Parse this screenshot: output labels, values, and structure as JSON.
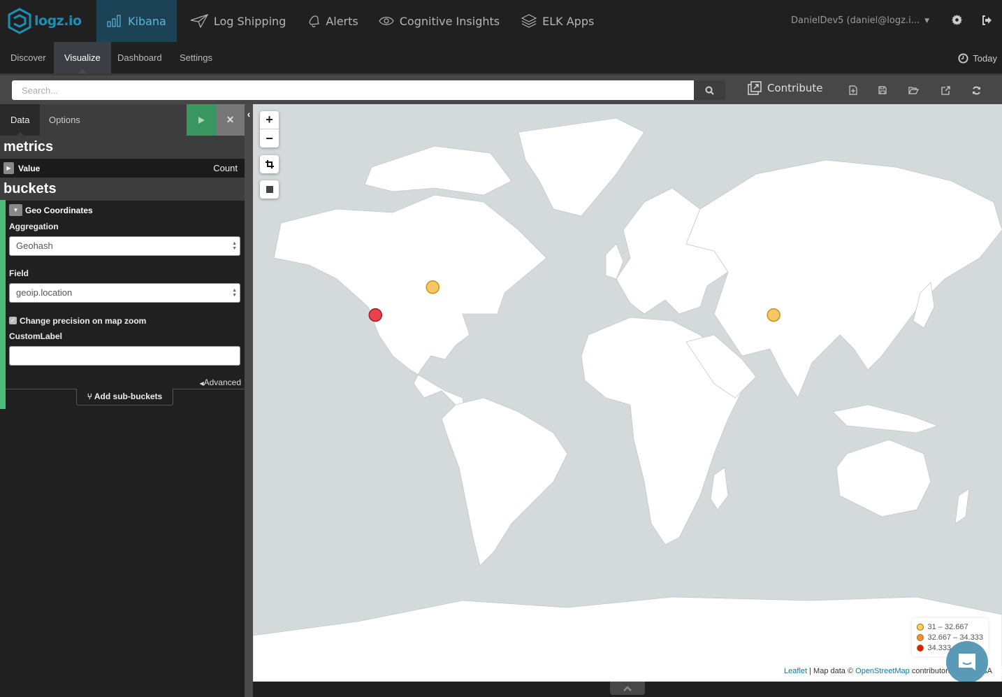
{
  "brand": {
    "name": "logz.io",
    "color": "#1c8fb8"
  },
  "topnav": {
    "items": [
      {
        "label": "Kibana",
        "icon": "bar-chart-icon",
        "active": true
      },
      {
        "label": "Log Shipping",
        "icon": "paper-plane-icon",
        "active": false
      },
      {
        "label": "Alerts",
        "icon": "bell-icon",
        "active": false
      },
      {
        "label": "Cognitive Insights",
        "icon": "eye-icon",
        "active": false
      },
      {
        "label": "ELK Apps",
        "icon": "layers-icon",
        "active": false
      }
    ],
    "user": "DanielDev5 (daniel@logz.i...",
    "settings_icon": "gear-icon",
    "logout_icon": "sign-out-icon"
  },
  "subnav": {
    "tabs": [
      {
        "label": "Discover",
        "active": false
      },
      {
        "label": "Visualize",
        "active": true
      },
      {
        "label": "Dashboard",
        "active": false
      },
      {
        "label": "Settings",
        "active": false
      }
    ],
    "time_label": "Today"
  },
  "toolbar": {
    "search_placeholder": "Search...",
    "search_value": "",
    "contribute_label": "Contribute",
    "icons": [
      "new-visualization-icon",
      "save-icon",
      "open-icon",
      "share-icon",
      "refresh-icon"
    ]
  },
  "sidebar": {
    "tabs": [
      {
        "label": "Data",
        "active": true
      },
      {
        "label": "Options",
        "active": false
      }
    ],
    "metrics_title": "metrics",
    "metric": {
      "name": "Value",
      "type": "Count"
    },
    "buckets_title": "buckets",
    "bucket": {
      "title": "Geo Coordinates",
      "aggregation_label": "Aggregation",
      "aggregation_value": "Geohash",
      "field_label": "Field",
      "field_value": "geoip.location",
      "precision_label": "Change precision on map zoom",
      "precision_checked": true,
      "custom_label_label": "CustomLabel",
      "custom_label_value": "",
      "advanced_label": "Advanced"
    },
    "add_sub_buckets_label": "Add sub-buckets"
  },
  "map": {
    "controls": {
      "zoom_in": "+",
      "zoom_out": "−"
    },
    "legend": [
      {
        "label": "31 – 32.667",
        "color": "#fdd35c"
      },
      {
        "label": "32.667 – 34.333",
        "color": "#fd8d3c"
      },
      {
        "label": "34.333 – 36",
        "color": "#e31a1c"
      }
    ],
    "markers": [
      {
        "name": "texas",
        "lat": 30.5,
        "lon": -97.5,
        "color": "#e8424a",
        "stroke": "#a81a22"
      },
      {
        "name": "virginia",
        "lat": 38.5,
        "lon": -77.5,
        "color": "#f5c768",
        "stroke": "#c79416"
      },
      {
        "name": "middle-east",
        "lat": 30.5,
        "lon": 41.5,
        "color": "#f5c768",
        "stroke": "#c79416"
      }
    ],
    "attribution": {
      "leaflet": "Leaflet",
      "separator": " | Map data © ",
      "osm": "OpenStreetMap",
      "suffix": " contributors, CC-BY-SA"
    }
  }
}
